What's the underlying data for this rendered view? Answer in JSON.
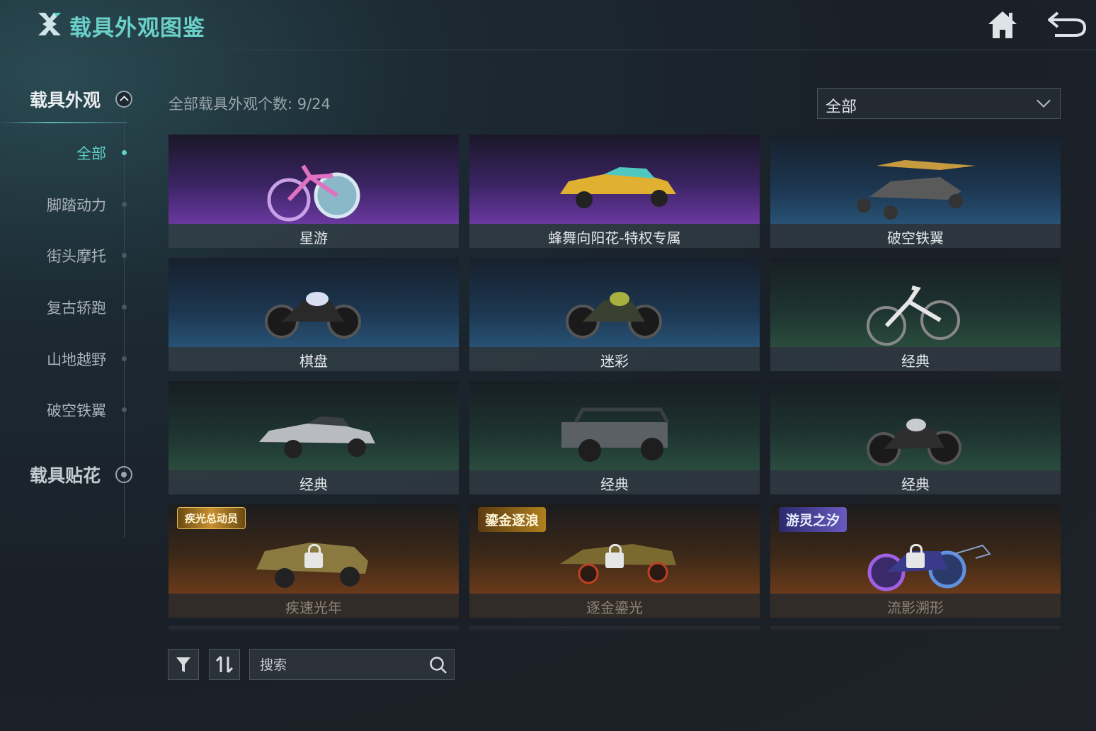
{
  "header": {
    "title": "载具外观图鉴",
    "home_icon": "home-icon",
    "back_icon": "back-icon"
  },
  "sidebar": {
    "section1": "载具外观",
    "items": [
      {
        "label": "全部",
        "active": true
      },
      {
        "label": "脚踏动力",
        "active": false
      },
      {
        "label": "街头摩托",
        "active": false
      },
      {
        "label": "复古轿跑",
        "active": false
      },
      {
        "label": "山地越野",
        "active": false
      },
      {
        "label": "破空铁翼",
        "active": false
      }
    ],
    "section2": "载具贴花"
  },
  "main": {
    "count_label": "全部载具外观个数: 9/24",
    "filter": {
      "selected": "全部"
    },
    "cards": [
      {
        "name": "星游",
        "locked": false,
        "badge": ""
      },
      {
        "name": "蜂舞向阳花-特权专属",
        "locked": false,
        "badge": ""
      },
      {
        "name": "破空铁翼",
        "locked": false,
        "badge": ""
      },
      {
        "name": "棋盘",
        "locked": false,
        "badge": ""
      },
      {
        "name": "迷彩",
        "locked": false,
        "badge": ""
      },
      {
        "name": "经典",
        "locked": false,
        "badge": ""
      },
      {
        "name": "经典",
        "locked": false,
        "badge": ""
      },
      {
        "name": "经典",
        "locked": false,
        "badge": ""
      },
      {
        "name": "经典",
        "locked": false,
        "badge": ""
      },
      {
        "name": "疾速光年",
        "locked": true,
        "badge": "疾光总动员"
      },
      {
        "name": "逐金鎏光",
        "locked": true,
        "badge": "鎏金逐浪"
      },
      {
        "name": "流影溯形",
        "locked": true,
        "badge": "游灵之汐"
      }
    ]
  },
  "bottom": {
    "search_placeholder": "搜索"
  },
  "colors": {
    "accent": "#5fd2c8",
    "title": "#6ad0c8"
  }
}
